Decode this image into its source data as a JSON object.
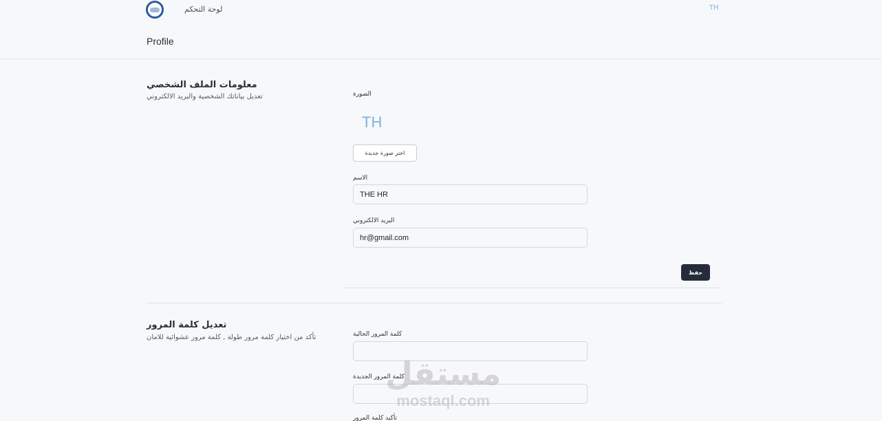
{
  "header": {
    "nav_link": "لوحة التحكم",
    "user_initials": "TH",
    "page_title": "Profile"
  },
  "profile_section": {
    "title": "معلومات الملف الشخصي",
    "description": "تعديل بياناتك الشخصية والبريد الالكتروني",
    "photo_label": "الصورة",
    "photo_initials": "TH",
    "choose_photo_label": "اختر صورة جديدة",
    "name_label": "الاسم",
    "name_value": "THE HR",
    "email_label": "البريد الالكتروني",
    "email_value": "hr@gmail.com",
    "save_label": "حفظ"
  },
  "password_section": {
    "title": "تعديل كلمة المرور",
    "description": "تأكد من اختيار كلمة مرور طولة , كلمة مرور عشوائية للامان",
    "current_password_label": "كلمة المرور الحالية",
    "new_password_label": "كلمة المرور الجديدة",
    "confirm_password_label": "تأكيد كلمة المرور"
  },
  "watermark": {
    "arabic": "مستقل",
    "latin": "mostaql.com"
  }
}
